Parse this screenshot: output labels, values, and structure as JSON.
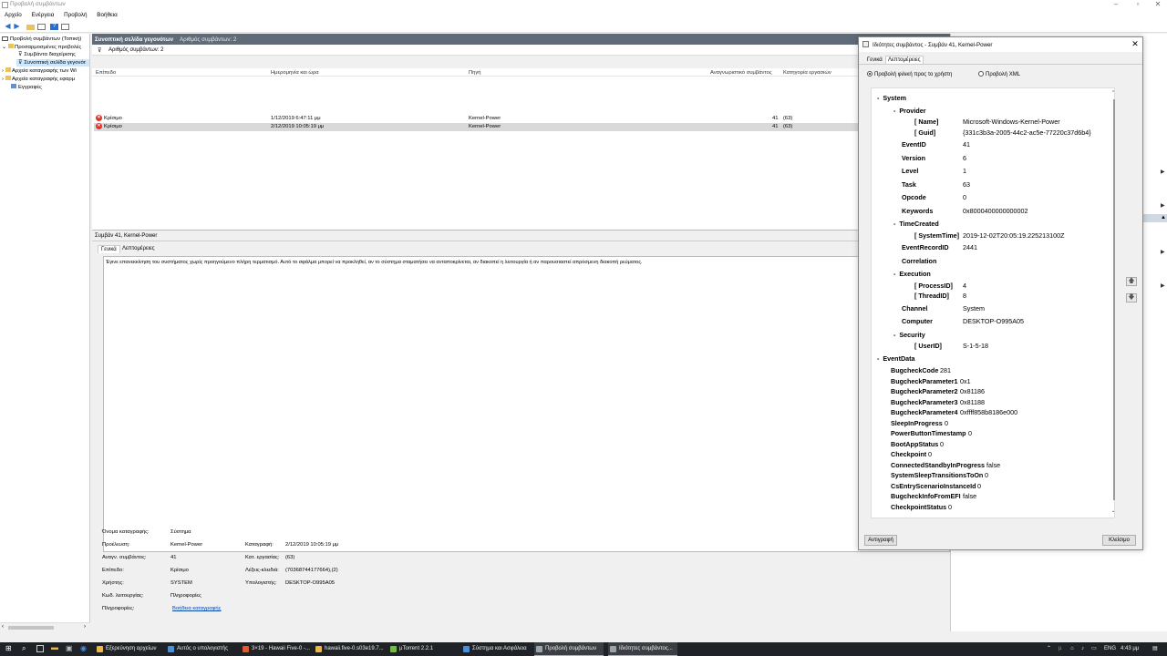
{
  "window": {
    "title": "Προβολή συμβάντων"
  },
  "menu": [
    "Αρχείο",
    "Ενέργεια",
    "Προβολή",
    "Βοήθεια"
  ],
  "tree": {
    "items": [
      {
        "label": "Προβολή συμβάντων (Τοπική)"
      },
      {
        "label": "Προσαρμοσμένες προβολές"
      },
      {
        "label": "Συμβάντα διαχείρισης"
      },
      {
        "label": "Συνοπτική σελίδα γεγονότ"
      },
      {
        "label": "Αρχεία καταγραφής των Wi"
      },
      {
        "label": "Αρχεία καταγραφής εφαρμ"
      },
      {
        "label": "Εγγραφές"
      }
    ]
  },
  "center": {
    "header_title": "Συνοπτική σελίδα γεγονότων",
    "header_count": "Αριθμός συμβάντων: 2",
    "filter_text": "Αριθμός συμβάντων: 2",
    "columns": [
      "Επίπεδο",
      "Ημερομηνία και ώρα",
      "Πηγή",
      "Αναγνωριστικό συμβάντος",
      "Κατηγορία εργασιών"
    ],
    "rows": [
      {
        "level": "Κρίσιμο",
        "datetime": "1/12/2019 6:47:11 μμ",
        "source": "Kernel-Power",
        "id": "41",
        "category": "(63)"
      },
      {
        "level": "Κρίσιμο",
        "datetime": "2/12/2019 10:05:19 μμ",
        "source": "Kernel-Power",
        "id": "41",
        "category": "(63)"
      }
    ],
    "detail_title": "Συμβάν 41, Kernel-Power",
    "detail_tabs": [
      "Γενικά",
      "Λεπτομέρειες"
    ],
    "message": "Έγινε επανεκκίνηση του συστήματος χωρίς προηγούμενο πλήρη τερματισμό. Αυτό το σφάλμα μπορεί να προκληθεί, αν το σύστημα σταματήσει να ανταποκρίνεται, αν διακοπεί η λειτουργία ή αν παρουσιαστεί απρόσμενη διακοπή ρεύματος.",
    "props": {
      "log_name_label": "Όνομα καταγραφής:",
      "log_name": "Σύστημα",
      "source_label": "Προέλευση:",
      "source": "Kernel-Power",
      "logged_label": "Καταγραφή:",
      "logged": "2/12/2019 10:05:19 μμ",
      "event_id_label": "Αναγν. συμβάντος:",
      "event_id": "41",
      "task_label": "Κατ. εργασίας:",
      "task": "(63)",
      "level_label": "Επίπεδο:",
      "level": "Κρίσιμο",
      "keywords_label": "Λέξεις-κλειδιά:",
      "keywords": "(70368744177664),(2)",
      "user_label": "Χρήστης:",
      "user": "SYSTEM",
      "computer_label": "Υπολογιστής:",
      "computer": "DESKTOP-O995A05",
      "opcode_label": "Κωδ. λειτουργίας:",
      "opcode": "Πληροφορίες",
      "info_label": "Πληροφορίες:",
      "info_link": "Βοήθεια καταγραφής"
    }
  },
  "dialog": {
    "title": "Ιδιότητες συμβάντος - Συμβάν 41, Kernel-Power",
    "tabs": [
      "Γενικά",
      "Λεπτομέρειες"
    ],
    "radio_friendly": "Προβολή φιλική προς το χρήστη",
    "radio_xml": "Προβολή XML",
    "copy_button": "Αντιγραφή",
    "close_button": "Κλείσιμο",
    "xml": {
      "system": "System",
      "provider": "Provider",
      "name_key": "[ Name]",
      "name_val": "Microsoft-Windows-Kernel-Power",
      "guid_key": "[ Guid]",
      "guid_val": "{331c3b3a-2005-44c2-ac5e-77220c37d6b4}",
      "eventid_key": "EventID",
      "eventid_val": "41",
      "version_key": "Version",
      "version_val": "6",
      "level_key": "Level",
      "level_val": "1",
      "task_key": "Task",
      "task_val": "63",
      "opcode_key": "Opcode",
      "opcode_val": "0",
      "keywords_key": "Keywords",
      "keywords_val": "0x8000400000000002",
      "timecreated": "TimeCreated",
      "systemtime_key": "[ SystemTime]",
      "systemtime_val": "2019-12-02T20:05:19.225213100Z",
      "recordid_key": "EventRecordID",
      "recordid_val": "2441",
      "correlation": "Correlation",
      "execution": "Execution",
      "processid_key": "[ ProcessID]",
      "processid_val": "4",
      "threadid_key": "[ ThreadID]",
      "threadid_val": "8",
      "channel_key": "Channel",
      "channel_val": "System",
      "computer_key": "Computer",
      "computer_val": "DESKTOP-O995A05",
      "security": "Security",
      "userid_key": "[ UserID]",
      "userid_val": "S-1-5-18",
      "eventdata": "EventData",
      "data": [
        {
          "k": "BugcheckCode",
          "v": "281"
        },
        {
          "k": "BugcheckParameter1",
          "v": "0x1"
        },
        {
          "k": "BugcheckParameter2",
          "v": "0x81186"
        },
        {
          "k": "BugcheckParameter3",
          "v": "0x81188"
        },
        {
          "k": "BugcheckParameter4",
          "v": "0xffff858b8186e000"
        },
        {
          "k": "SleepInProgress",
          "v": "0"
        },
        {
          "k": "PowerButtonTimestamp",
          "v": "0"
        },
        {
          "k": "BootAppStatus",
          "v": "0"
        },
        {
          "k": "Checkpoint",
          "v": "0"
        },
        {
          "k": "ConnectedStandbyInProgress",
          "v": "false"
        },
        {
          "k": "SystemSleepTransitionsToOn",
          "v": "0"
        },
        {
          "k": "CsEntryScenarioInstanceId",
          "v": "0"
        },
        {
          "k": "BugcheckInfoFromEFI",
          "v": "false"
        },
        {
          "k": "CheckpointStatus",
          "v": "0"
        }
      ]
    }
  },
  "taskbar": {
    "items": [
      {
        "label": "Εξερεύνηση αρχείων",
        "color": "#e8b84a"
      },
      {
        "label": "Αυτός ο υπολογιστής",
        "color": "#4a90d9"
      },
      {
        "label": "3×19 - Hawaii Five-0 -...",
        "color": "#e05a2b"
      },
      {
        "label": "hawaii.five-0.s03e19.7...",
        "color": "#e8b84a"
      },
      {
        "label": "µTorrent 2.2.1",
        "color": "#6fbf3f"
      },
      {
        "label": "Σύστημα και Ασφάλεια",
        "color": "#4a90d9"
      },
      {
        "label": "Προβολή συμβάντων",
        "color": "#9aa4ad"
      },
      {
        "label": "Ιδιότητες συμβάντος...",
        "color": "#9aa4ad"
      }
    ],
    "lang": "ENG",
    "time": "4:43 μμ"
  },
  "colors": {
    "header_bg": "#5f6b78",
    "critical": "#d9342b",
    "taskbar": "#1f2226"
  }
}
